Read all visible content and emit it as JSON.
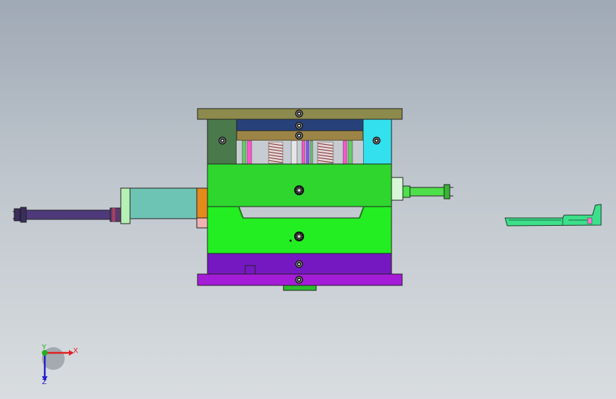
{
  "viewport": {
    "background_top": "#9fa9b5",
    "background_bottom": "#d9dde0"
  },
  "model": {
    "colors": {
      "top_clamp_plate": "#8c8a4c",
      "stripper_plate": "#27417a",
      "ejector_retainer": "#9c8446",
      "left_support": "#4a7a4c",
      "right_support": "#33e0ee",
      "cavity_plate": "#2ed62e",
      "core_plate": "#22ee22",
      "support_plate": "#7618c2",
      "bottom_clamp_plate": "#a51cd8",
      "cylinder_body": "#6ec4b4",
      "cylinder_rod": "#4e3a7a",
      "orange_block": "#e48a1a",
      "side_cylinder": "#4ee04a",
      "part": "#3ce08a"
    },
    "icons": [
      "screw-icon",
      "spring-icon"
    ]
  },
  "triad": {
    "x_label": "X",
    "y_label": "Y",
    "z_label": "Z",
    "x_color": "#e02020",
    "y_color": "#20b020",
    "z_color": "#2020d0"
  }
}
